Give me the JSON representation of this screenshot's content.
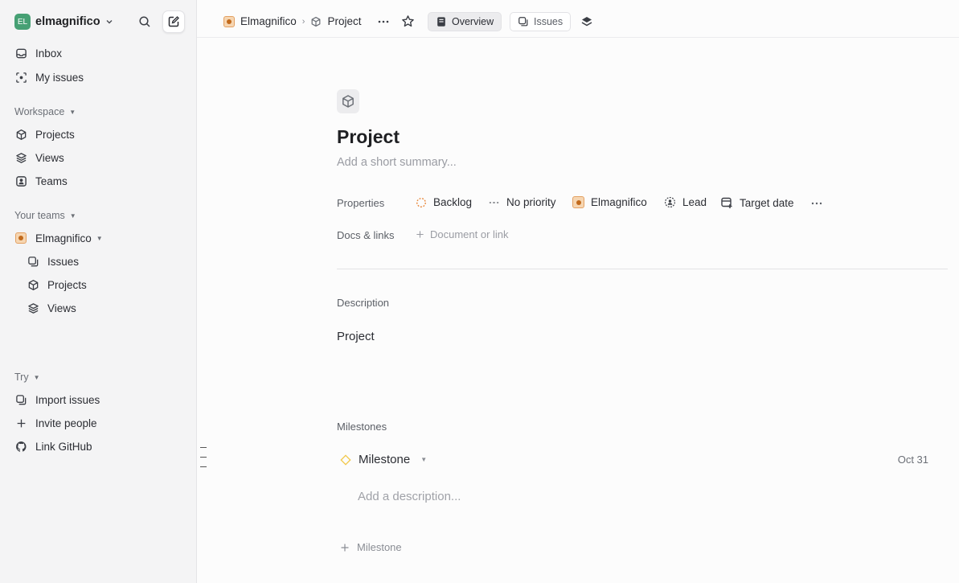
{
  "workspace": {
    "initials": "EL",
    "name": "elmagnifico"
  },
  "sidebar": {
    "inbox": "Inbox",
    "my_issues": "My issues",
    "workspace_section": "Workspace",
    "projects": "Projects",
    "views": "Views",
    "teams": "Teams",
    "your_teams_section": "Your teams",
    "team_name": "Elmagnifico",
    "team_issues": "Issues",
    "team_projects": "Projects",
    "team_views": "Views",
    "try_section": "Try",
    "import_issues": "Import issues",
    "invite_people": "Invite people",
    "link_github": "Link GitHub"
  },
  "topbar": {
    "crumb_team": "Elmagnifico",
    "crumb_project": "Project",
    "tab_overview": "Overview",
    "tab_issues": "Issues"
  },
  "project": {
    "title": "Project",
    "summary_placeholder": "Add a short summary...",
    "properties_label": "Properties",
    "status": "Backlog",
    "priority": "No priority",
    "team": "Elmagnifico",
    "lead": "Lead",
    "target_date": "Target date",
    "docs_label": "Docs & links",
    "docs_add": "Document or link",
    "description_label": "Description",
    "description": "Project",
    "milestones_label": "Milestones",
    "milestone_name": "Milestone",
    "milestone_date": "Oct 31",
    "milestone_desc_placeholder": "Add a description...",
    "add_milestone": "Milestone"
  },
  "colors": {
    "accent_green": "#46a074",
    "milestone_yellow": "#f2c94c",
    "backlog_orange": "#e8873a"
  }
}
